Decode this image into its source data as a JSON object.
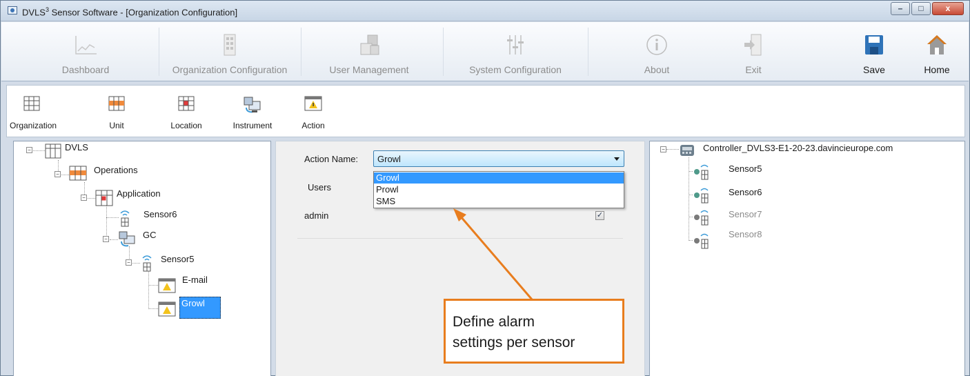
{
  "window": {
    "title_prefix": "DVLS",
    "title_sup": "3",
    "title_rest": " Sensor Software - [Organization Configuration]",
    "minimize": "–",
    "maximize": "□",
    "close": "x"
  },
  "toolbar": {
    "items": [
      {
        "label": "Dashboard",
        "icon": "dashboard-chart-icon"
      },
      {
        "label": "Organization Configuration",
        "icon": "building-icon"
      },
      {
        "label": "User Management",
        "icon": "users-icon"
      },
      {
        "label": "System Configuration",
        "icon": "sliders-icon"
      },
      {
        "label": "About",
        "icon": "info-icon"
      },
      {
        "label": "Exit",
        "icon": "exit-door-icon"
      },
      {
        "label": "Save",
        "icon": "floppy-disk-icon"
      },
      {
        "label": "Home",
        "icon": "home-icon"
      }
    ]
  },
  "subtoolbar": {
    "items": [
      {
        "label": "Organization",
        "icon": "grid-icon"
      },
      {
        "label": "Unit",
        "icon": "unit-grid-icon"
      },
      {
        "label": "Location",
        "icon": "location-grid-icon"
      },
      {
        "label": "Instrument",
        "icon": "instrument-computer-icon"
      },
      {
        "label": "Action",
        "icon": "warning-window-icon"
      }
    ]
  },
  "org_tree": {
    "root": "DVLS",
    "unit": "Operations",
    "location": "Application",
    "sensor_a": "Sensor6",
    "instrument": "GC",
    "sensor_b": "Sensor5",
    "action_email": "E-mail",
    "action_growl": "Growl"
  },
  "action_form": {
    "action_name_label": "Action Name:",
    "action_name_value": "Growl",
    "options": [
      "Growl",
      "Prowl",
      "SMS"
    ],
    "users_label": "Users",
    "user_name": "admin",
    "user_checked": "✓"
  },
  "controller_tree": {
    "controller": "Controller_DVLS3-E1-20-23.davincieurope.com",
    "sensors": [
      "Sensor5",
      "Sensor6",
      "Sensor7",
      "Sensor8"
    ]
  },
  "callout": {
    "line1": "Define alarm",
    "line2": "settings per sensor"
  },
  "colors": {
    "accent_orange": "#e87d1e",
    "selection_blue": "#3399ff",
    "save_blue": "#2f73b8"
  }
}
